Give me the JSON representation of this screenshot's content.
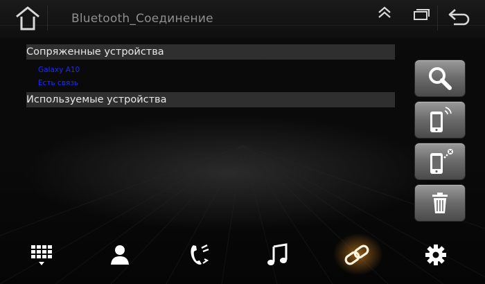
{
  "header": {
    "title": "Bluetooth_Соединение"
  },
  "sections": {
    "paired_title": "Сопряженные устройства",
    "paired_devices": [
      {
        "name": "Galaxy A10",
        "status": "Есть связь"
      }
    ],
    "used_title": "Используемые устройства"
  },
  "colors": {
    "accent": "#f0a030",
    "device_text": "#1d2bff"
  },
  "icons": {
    "top": [
      "home-icon",
      "collapse-icon",
      "window-icon",
      "back-icon"
    ],
    "side": [
      "search-icon",
      "phone-connect-icon",
      "phone-disconnect-icon",
      "trash-icon"
    ],
    "nav": [
      "dialpad-icon",
      "contacts-icon",
      "call-log-icon",
      "music-icon",
      "link-icon",
      "settings-icon"
    ]
  }
}
